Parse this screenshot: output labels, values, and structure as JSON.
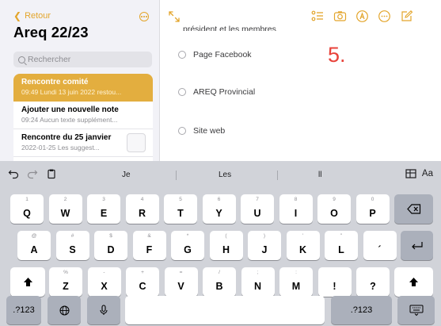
{
  "sidebar": {
    "back_label": "Retour",
    "folder_title": "Areq 22/23",
    "search_placeholder": "Rechercher",
    "notes": [
      {
        "title": "Rencontre comité",
        "subtitle": "09:49  Lundi 13 juin 2022 restou...",
        "selected": true
      },
      {
        "title": "Ajouter une nouvelle note",
        "subtitle": "09:24  Aucun texte supplément...",
        "selected": false
      },
      {
        "title": "Rencontre du 25 janvier",
        "subtitle": "2022-01-25  Les suggest...",
        "selected": false
      }
    ]
  },
  "editor": {
    "cut_text": "président et les membres",
    "checklist": [
      "Page Facebook",
      "AREQ Provincial",
      "Site web"
    ],
    "big_number": "5."
  },
  "keyboard": {
    "suggestions": [
      "Je",
      "Les",
      "ll"
    ],
    "format_label": "Aa",
    "row1": [
      {
        "main": "Q",
        "hint": "1"
      },
      {
        "main": "W",
        "hint": "2"
      },
      {
        "main": "E",
        "hint": "3"
      },
      {
        "main": "R",
        "hint": "4"
      },
      {
        "main": "T",
        "hint": "5"
      },
      {
        "main": "Y",
        "hint": "6"
      },
      {
        "main": "U",
        "hint": "7"
      },
      {
        "main": "I",
        "hint": "8"
      },
      {
        "main": "O",
        "hint": "9"
      },
      {
        "main": "P",
        "hint": "0"
      }
    ],
    "row2": [
      {
        "main": "A",
        "hint": "@"
      },
      {
        "main": "S",
        "hint": "#"
      },
      {
        "main": "D",
        "hint": "$"
      },
      {
        "main": "F",
        "hint": "&"
      },
      {
        "main": "G",
        "hint": "*"
      },
      {
        "main": "H",
        "hint": "("
      },
      {
        "main": "J",
        "hint": ")"
      },
      {
        "main": "K",
        "hint": "'"
      },
      {
        "main": "L",
        "hint": "\""
      },
      {
        "main": "´",
        "hint": ""
      }
    ],
    "row3": [
      {
        "main": "Z",
        "hint": "%"
      },
      {
        "main": "X",
        "hint": "-"
      },
      {
        "main": "C",
        "hint": "+"
      },
      {
        "main": "V",
        "hint": "="
      },
      {
        "main": "B",
        "hint": "/"
      },
      {
        "main": "N",
        "hint": ";"
      },
      {
        "main": "M",
        "hint": ":"
      },
      {
        "main": "!",
        "hint": ""
      },
      {
        "main": "?",
        "hint": ""
      }
    ],
    "num_label": ".?123"
  },
  "colors": {
    "accent": "#e3a52b",
    "selected_note": "#e3ae3f",
    "number_red": "#e8423a",
    "keyboard_bg": "#d1d3d9"
  }
}
